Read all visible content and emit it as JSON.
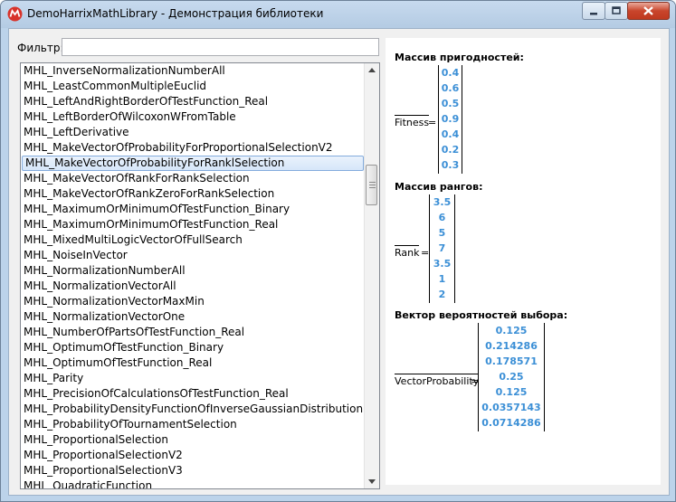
{
  "window": {
    "title": "DemoHarrixMathLibrary - Демонстрация библиотеки"
  },
  "filter": {
    "label": "Фильтр:",
    "value": ""
  },
  "list": {
    "selected_index": 6,
    "items": [
      "MHL_InverseNormalizationNumberAll",
      "MHL_LeastCommonMultipleEuclid",
      "MHL_LeftAndRightBorderOfTestFunction_Real",
      "MHL_LeftBorderOfWilcoxonWFromTable",
      "MHL_LeftDerivative",
      "MHL_MakeVectorOfProbabilityForProportionalSelectionV2",
      "MHL_MakeVectorOfProbabilityForRanklSelection",
      "MHL_MakeVectorOfRankForRankSelection",
      "MHL_MakeVectorOfRankZeroForRankSelection",
      "MHL_MaximumOrMinimumOfTestFunction_Binary",
      "MHL_MaximumOrMinimumOfTestFunction_Real",
      "MHL_MixedMultiLogicVectorOfFullSearch",
      "MHL_NoiseInVector",
      "MHL_NormalizationNumberAll",
      "MHL_NormalizationVectorAll",
      "MHL_NormalizationVectorMaxMin",
      "MHL_NormalizationVectorOne",
      "MHL_NumberOfPartsOfTestFunction_Real",
      "MHL_OptimumOfTestFunction_Binary",
      "MHL_OptimumOfTestFunction_Real",
      "MHL_Parity",
      "MHL_PrecisionOfCalculationsOfTestFunction_Real",
      "MHL_ProbabilityDensityFunctionOfInverseGaussianDistribution",
      "MHL_ProbabilityOfTournamentSelection",
      "MHL_ProportionalSelection",
      "MHL_ProportionalSelectionV2",
      "MHL_ProportionalSelectionV3",
      "MHL_QuadraticFunction"
    ]
  },
  "output": {
    "fitness": {
      "heading": "Массив пригодностей:",
      "var": "Fitness",
      "eq": "=",
      "values": [
        "0.4",
        "0.6",
        "0.5",
        "0.9",
        "0.4",
        "0.2",
        "0.3"
      ]
    },
    "rank": {
      "heading": "Массив рангов:",
      "var": "Rank",
      "eq": "=",
      "values": [
        "3.5",
        "6",
        "5",
        "7",
        "3.5",
        "1",
        "2"
      ]
    },
    "probability": {
      "heading": "Вектор вероятностей выбора:",
      "var": "VectorProbability",
      "eq": "=",
      "values": [
        "0.125",
        "0.214286",
        "0.178571",
        "0.25",
        "0.125",
        "0.0357143",
        "0.0714286"
      ]
    }
  },
  "colors": {
    "value_blue": "#3b8fd6",
    "selection": "#d6e6f9"
  }
}
